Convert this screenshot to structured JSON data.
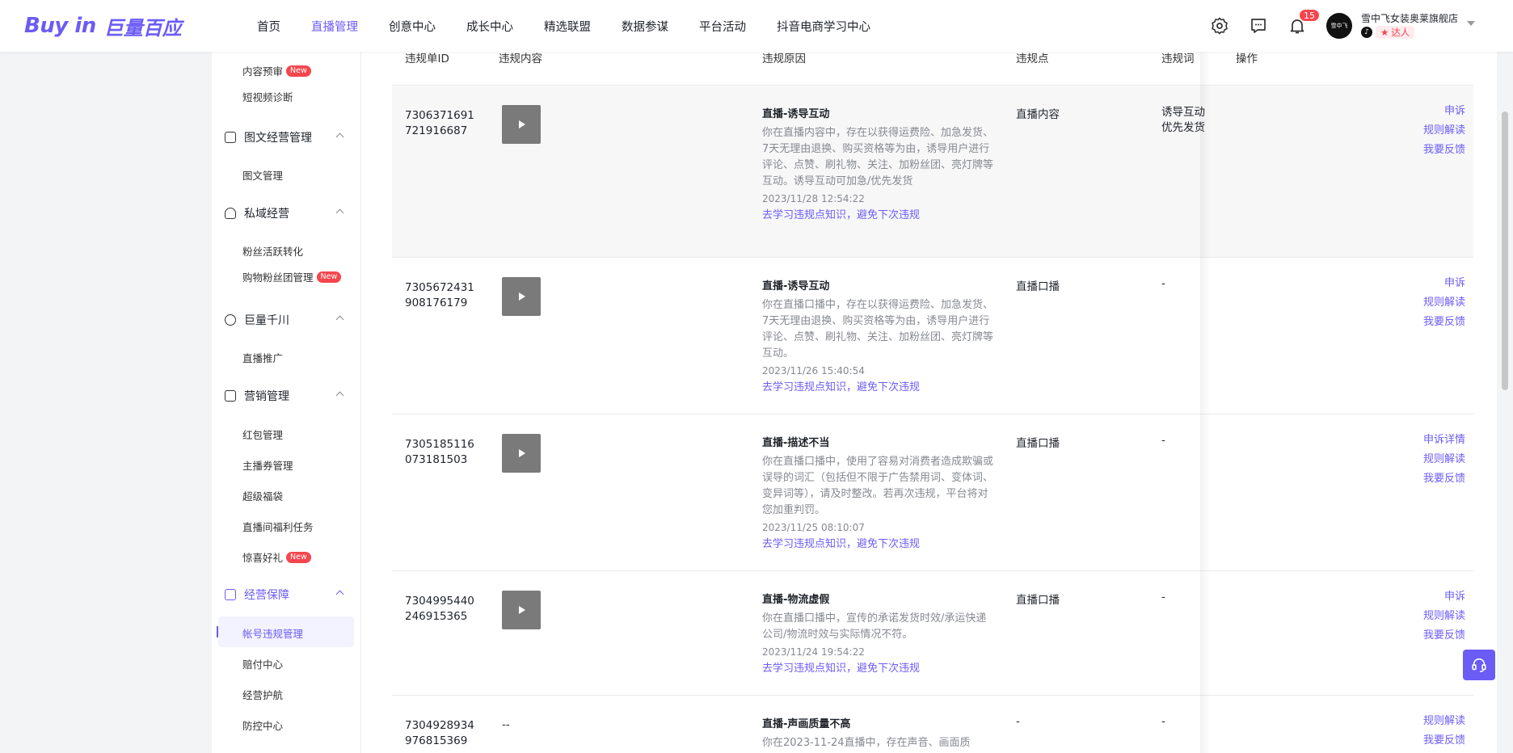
{
  "header": {
    "logo_en": "Buy in",
    "logo_cn": "巨量百应",
    "nav": [
      "首页",
      "直播管理",
      "创意中心",
      "成长中心",
      "精选联盟",
      "数据参谋",
      "平台活动",
      "抖音电商学习中心"
    ],
    "active_nav": "直播管理",
    "notification_count": "15",
    "avatar_text": "雪中飞",
    "user_name": "雪中飞女装奥莱旗舰店",
    "user_role": "达人"
  },
  "sidebar": {
    "groups": [
      {
        "label": "图文经营管理",
        "items": [
          "图文管理"
        ]
      },
      {
        "label": "私域经营",
        "items": [
          "粉丝活跃转化",
          "购物粉丝团管理"
        ]
      },
      {
        "label": "巨量千川",
        "items": [
          "直播推广"
        ]
      },
      {
        "label": "营销管理",
        "items": [
          "红包管理",
          "主播券管理",
          "超级福袋",
          "直播间福利任务",
          "惊喜好礼"
        ]
      },
      {
        "label": "经营保障",
        "items": [
          "帐号违规管理",
          "赔付中心",
          "经营护航",
          "防控中心"
        ]
      }
    ],
    "top_items": [
      "内容预审",
      "短视频诊断"
    ],
    "new_tag": "New"
  },
  "table": {
    "columns": [
      "违规单ID",
      "违规内容",
      "违规原因",
      "违规点",
      "违规词",
      "操作"
    ],
    "rows": [
      {
        "id": "7306371691721916687",
        "id_line1": "7306371691",
        "id_line2": "721916687",
        "reason_title": "直播-诱导互动",
        "reason_desc": "你在直播内容中，存在以获得运费险、加急发货、7天无理由退换、购买资格等为由，诱导用户进行评论、点赞、刷礼物、关注、加粉丝团、亮灯牌等互动。诱导互动可加急/优先发货",
        "time": "2023/11/28 12:54:22",
        "link": "去学习违规点知识，避免下次违规",
        "point": "直播内容",
        "word_line1": "诱导互动",
        "word_line2": "优先发货",
        "ops": [
          "申诉",
          "规则解读",
          "我要反馈"
        ]
      },
      {
        "id_line1": "7305672431",
        "id_line2": "908176179",
        "reason_title": "直播-诱导互动",
        "reason_desc": "你在直播口播中，存在以获得运费险、加急发货、7天无理由退换、购买资格等为由，诱导用户进行评论、点赞、刷礼物、关注、加粉丝团、亮灯牌等互动。",
        "time": "2023/11/26 15:40:54",
        "link": "去学习违规点知识，避免下次违规",
        "point": "直播口播",
        "word": "-",
        "ops": [
          "申诉",
          "规则解读",
          "我要反馈"
        ]
      },
      {
        "id_line1": "7305185116",
        "id_line2": "073181503",
        "reason_title": "直播-描述不当",
        "reason_desc": "你在直播口播中，使用了容易对消费者造成欺骗或误导的词汇（包括但不限于广告禁用词、变体词、变异词等），请及时整改。若再次违规，平台将对您加重判罚。",
        "time": "2023/11/25 08:10:07",
        "link": "去学习违规点知识，避免下次违规",
        "point": "直播口播",
        "word": "-",
        "ops": [
          "申诉详情",
          "规则解读",
          "我要反馈"
        ]
      },
      {
        "id_line1": "7304995440",
        "id_line2": "246915365",
        "reason_title": "直播-物流虚假",
        "reason_desc": "你在直播口播中，宣传的承诺发货时效/承运快递公司/物流时效与实际情况不符。",
        "time": "2023/11/24 19:54:22",
        "link": "去学习违规点知识，避免下次违规",
        "point": "直播口播",
        "word": "-",
        "ops": [
          "申诉",
          "规则解读",
          "我要反馈"
        ]
      },
      {
        "id_line1": "7304928934",
        "id_line2": "976815369",
        "content": "--",
        "reason_title": "直播-声画质量不高",
        "reason_desc": "你在2023-11-24直播中，存在声音、画面质",
        "point": "-",
        "word": "-",
        "ops": [
          "规则解读",
          "我要反馈"
        ]
      }
    ]
  },
  "colors": {
    "accent": "#6b5cf6",
    "danger": "#f5454d"
  }
}
